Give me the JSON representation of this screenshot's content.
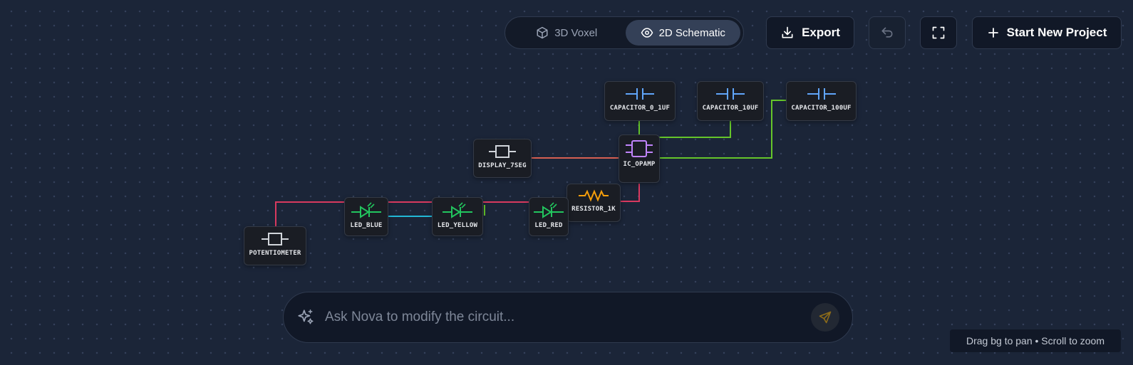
{
  "toolbar": {
    "view_3d_label": "3D Voxel",
    "view_2d_label": "2D Schematic",
    "active_view": "2D Schematic",
    "export_label": "Export",
    "new_project_label": "Start New Project"
  },
  "components": {
    "capacitor_0_1uf": "CAPACITOR_0_1UF",
    "capacitor_10uf": "CAPACITOR_10UF",
    "capacitor_100uf": "CAPACITOR_100UF",
    "display_7seg": "DISPLAY_7SEG",
    "ic_opamp": "IC_OPAMP",
    "resistor_1k": "RESISTOR_1K",
    "led_blue": "LED_BLUE",
    "led_yellow": "LED_YELLOW",
    "led_red": "LED_RED",
    "potentiometer": "POTENTIOMETER"
  },
  "chat": {
    "placeholder": "Ask Nova to modify the circuit..."
  },
  "hint": "Drag bg to pan • Scroll to zoom",
  "colors": {
    "capacitor": "#60a5fa",
    "ic": "#c084fc",
    "resistor": "#f59e0b",
    "led": "#22c55e",
    "generic": "#d1d5db",
    "wire_green": "#65c52a",
    "wire_red": "#d8395f",
    "wire_salmon": "#d65f52",
    "wire_cyan": "#22b8d6"
  }
}
